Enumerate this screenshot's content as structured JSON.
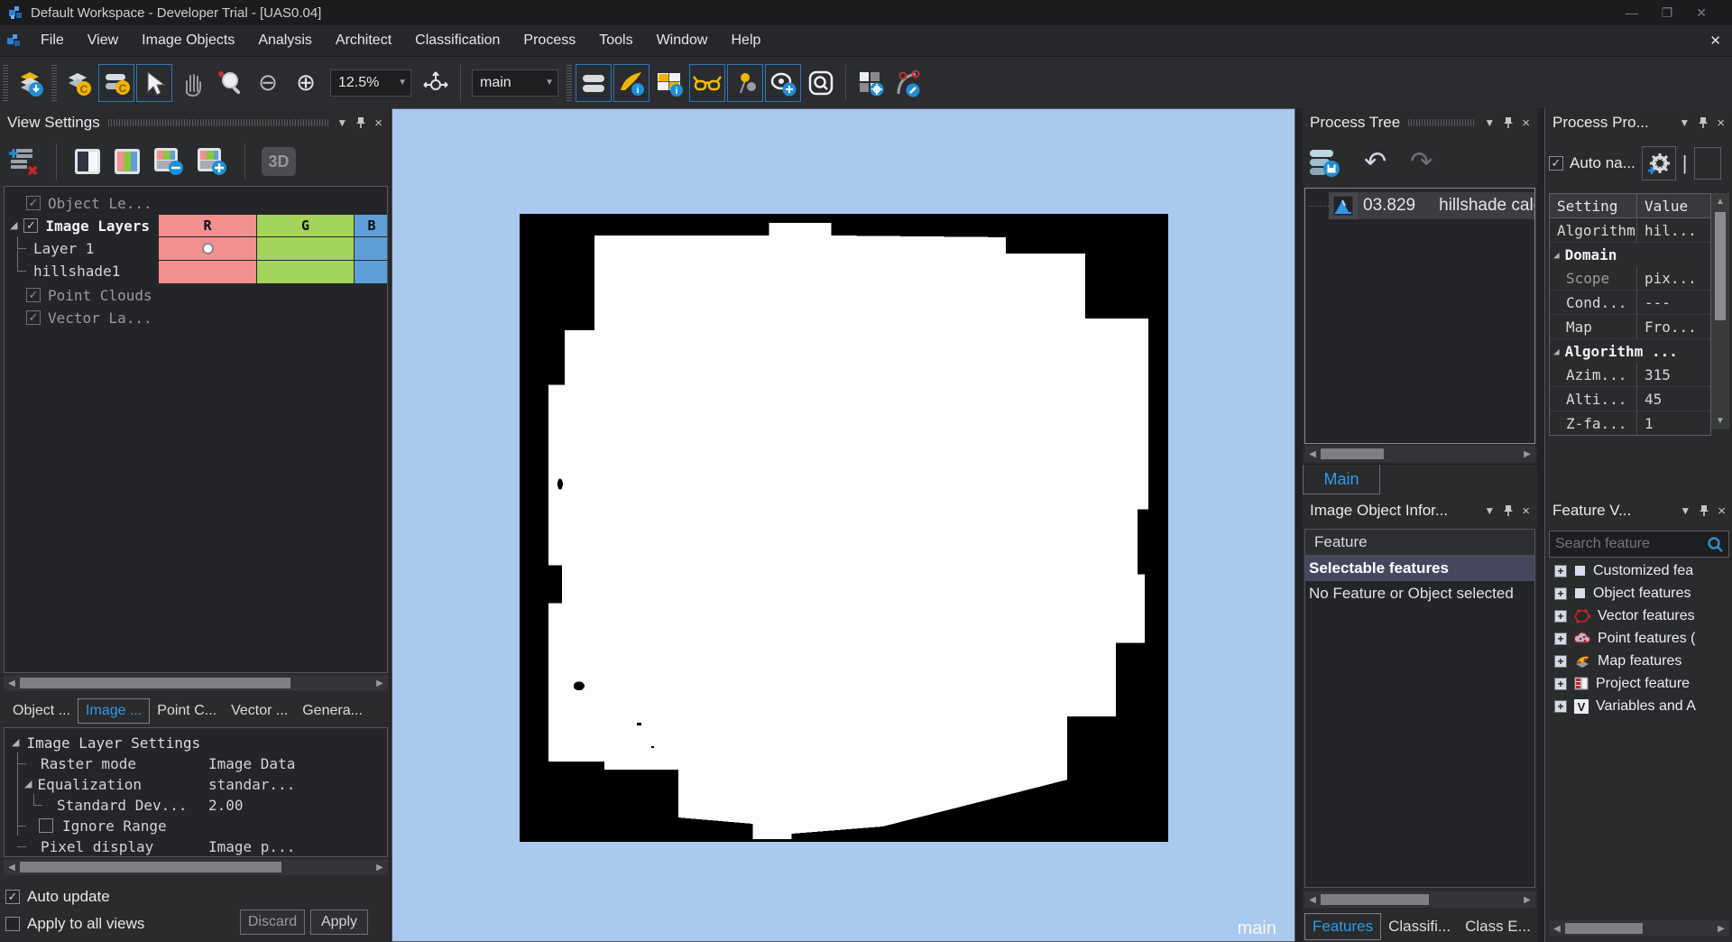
{
  "window": {
    "title": "Default Workspace - Developer Trial - [UAS0.04]"
  },
  "menu": {
    "items": [
      "File",
      "View",
      "Image Objects",
      "Analysis",
      "Architect",
      "Classification",
      "Process",
      "Tools",
      "Window",
      "Help"
    ]
  },
  "toolbar": {
    "zoom_level": "12.5%",
    "map_select": "main"
  },
  "view_settings": {
    "title": "View Settings",
    "threed_label": "3D",
    "tree": {
      "object_levels": "Object Le...",
      "image_layers": "Image Layers",
      "columns": [
        "R",
        "G",
        "B"
      ],
      "layers": [
        {
          "name": "Layer 1"
        },
        {
          "name": "hillshade1"
        }
      ],
      "point_clouds": "Point Clouds",
      "vector_layers": "Vector La..."
    },
    "tabs": [
      "Object ...",
      "Image ...",
      "Point C...",
      "Vector ...",
      "Genera..."
    ]
  },
  "image_layer_settings": {
    "root": "Image Layer Settings",
    "rows": [
      {
        "label": "Raster mode",
        "value": "Image Data"
      },
      {
        "label": "Equalization",
        "value": "standar..."
      },
      {
        "label": "Standard Dev...",
        "value": "2.00"
      },
      {
        "label": "Ignore Range",
        "value": ""
      },
      {
        "label": "Pixel display",
        "value": "Image p..."
      }
    ],
    "auto_update": "Auto update",
    "apply_to_all_views": "Apply to all views",
    "discard": "Discard",
    "apply": "Apply"
  },
  "viewer": {
    "map_label": "main",
    "background": "#a9c9ee"
  },
  "process_tree": {
    "title": "Process Tree",
    "item": {
      "number": "03.829",
      "name": "hillshade calcu"
    },
    "tab": "Main"
  },
  "image_object_info": {
    "title": "Image Object Infor...",
    "header": "Feature",
    "rows": [
      "Selectable features",
      "No Feature or Object selected"
    ],
    "tabs": [
      "Features",
      "Classifi...",
      "Class E..."
    ]
  },
  "process_properties": {
    "title": "Process Pro...",
    "auto_name": "Auto na...",
    "table": {
      "headers": [
        "Setting",
        "Value"
      ],
      "rows": [
        {
          "label": "Algorithm",
          "value": "hil...",
          "group": false
        },
        {
          "label": "Domain",
          "value": "",
          "group": true
        },
        {
          "label": "Scope",
          "value": "pix...",
          "group": false
        },
        {
          "label": "Cond...",
          "value": "---",
          "group": false
        },
        {
          "label": "Map",
          "value": "Fro...",
          "group": false
        },
        {
          "label": "Algorithm ...",
          "value": "",
          "group": true
        },
        {
          "label": "Azim...",
          "value": "315",
          "group": false
        },
        {
          "label": "Alti...",
          "value": "45",
          "group": false
        },
        {
          "label": "Z-fa...",
          "value": "1",
          "group": false
        }
      ]
    }
  },
  "feature_view": {
    "title": "Feature V...",
    "search_placeholder": "Search feature",
    "items": [
      "Customized fea",
      "Object features",
      "Vector features",
      "Point features (",
      "Map features",
      "Project feature",
      "Variables and A"
    ]
  },
  "colors": {
    "accent_blue": "#2e9ae8",
    "selected_row": "#46475f",
    "red_cell": "#f28f8f",
    "green_cell": "#a5d45a",
    "blue_cell": "#5f9fd8",
    "viewer_blue": "#a9c9ee"
  }
}
